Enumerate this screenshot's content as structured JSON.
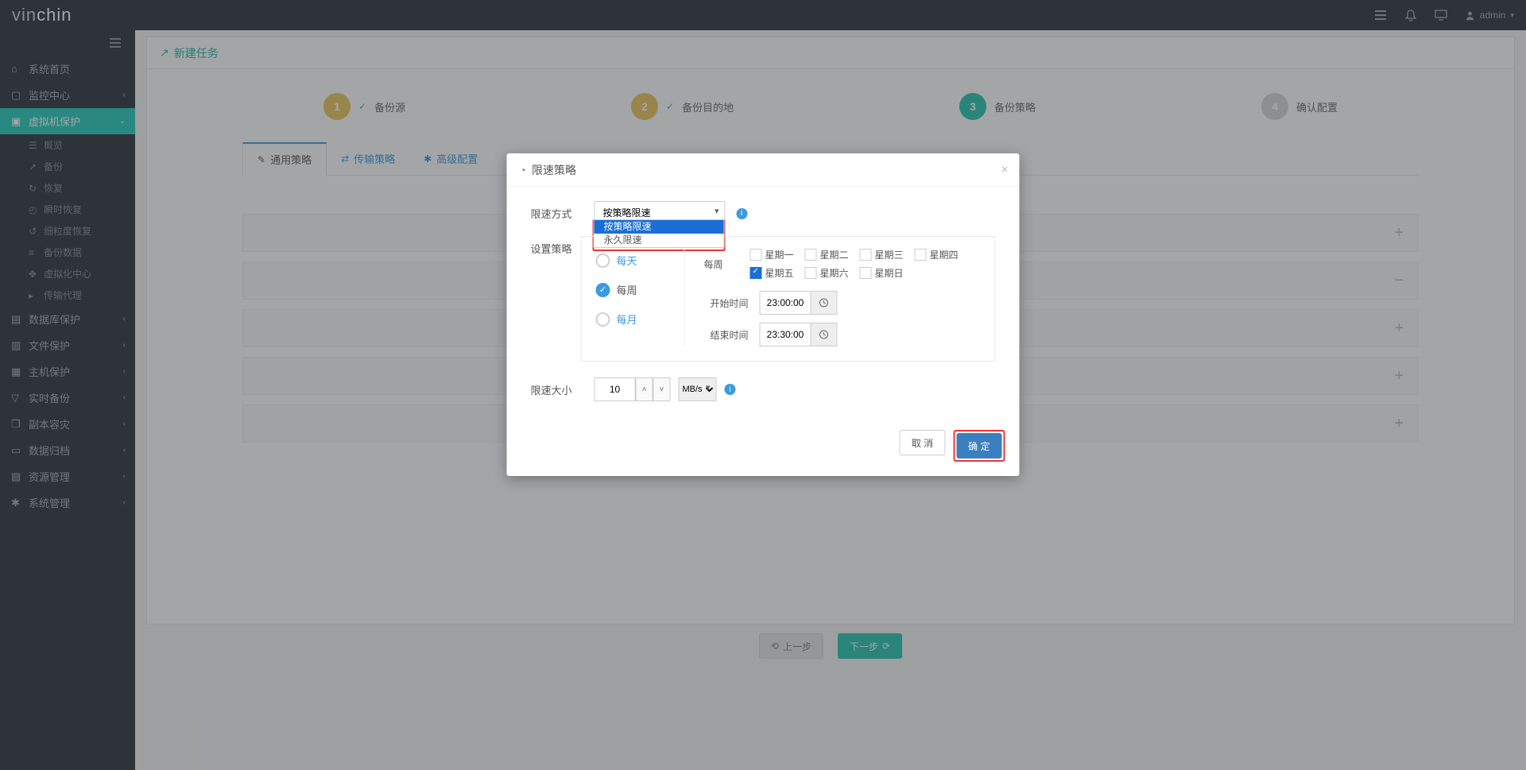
{
  "header": {
    "logo_text": "vinchin",
    "user_label": "admin"
  },
  "sidebar": {
    "items": [
      {
        "icon": "home",
        "label": "系统首页",
        "sub": []
      },
      {
        "icon": "monitor",
        "label": "监控中心",
        "caret": true,
        "sub": []
      },
      {
        "icon": "vm",
        "label": "虚拟机保护",
        "caret": true,
        "active": true,
        "sub": [
          {
            "icon": "dashboard",
            "label": "概览"
          },
          {
            "icon": "share",
            "label": "备份"
          },
          {
            "icon": "refresh",
            "label": "恢复"
          },
          {
            "icon": "clock",
            "label": "瞬时恢复"
          },
          {
            "icon": "refresh2",
            "label": "细粒度恢复"
          },
          {
            "icon": "db",
            "label": "备份数据"
          },
          {
            "icon": "gear",
            "label": "虚拟化中心"
          },
          {
            "icon": "agent",
            "label": "传输代理"
          }
        ]
      },
      {
        "icon": "db2",
        "label": "数据库保护",
        "caret": true
      },
      {
        "icon": "file",
        "label": "文件保护",
        "caret": true
      },
      {
        "icon": "host",
        "label": "主机保护",
        "caret": true
      },
      {
        "icon": "shield",
        "label": "实时备份",
        "caret": true
      },
      {
        "icon": "copy",
        "label": "副本容灾",
        "caret": true
      },
      {
        "icon": "archive",
        "label": "数据归档",
        "caret": true
      },
      {
        "icon": "res",
        "label": "资源管理",
        "caret": true
      },
      {
        "icon": "sys",
        "label": "系统管理",
        "caret": true
      }
    ]
  },
  "panel": {
    "title": "新建任务"
  },
  "steps": [
    {
      "num": "1",
      "label": "备份源",
      "state": "done"
    },
    {
      "num": "2",
      "label": "备份目的地",
      "state": "done"
    },
    {
      "num": "3",
      "label": "备份策略",
      "state": "current"
    },
    {
      "num": "4",
      "label": "确认配置",
      "state": "future"
    }
  ],
  "tabs": [
    {
      "icon": "✎",
      "label": "通用策略",
      "active": true
    },
    {
      "icon": "⇄",
      "label": "传输策略"
    },
    {
      "icon": "✱",
      "label": "高级配置"
    }
  ],
  "wizard_buttons": {
    "prev": "上一步",
    "next": "下一步"
  },
  "modal": {
    "title": "限速策略",
    "rate_mode_label": "限速方式",
    "rate_mode_value": "按策略限速",
    "rate_mode_options": [
      "按策略限速",
      "永久限速"
    ],
    "policy_label": "设置策略",
    "freq_options": {
      "daily": "每天",
      "weekly": "每周",
      "monthly": "每月"
    },
    "weekly_label": "每周",
    "days": [
      "星期一",
      "星期二",
      "星期三",
      "星期四",
      "星期五",
      "星期六",
      "星期日"
    ],
    "days_checked": [
      false,
      false,
      false,
      false,
      true,
      false,
      false
    ],
    "start_label": "开始时间",
    "end_label": "结束时间",
    "start_value": "23:00:00",
    "end_value": "23:30:00",
    "rate_size_label": "限速大小",
    "rate_size_value": "10",
    "rate_unit": "MB/s",
    "cancel": "取 消",
    "ok": "确 定"
  }
}
